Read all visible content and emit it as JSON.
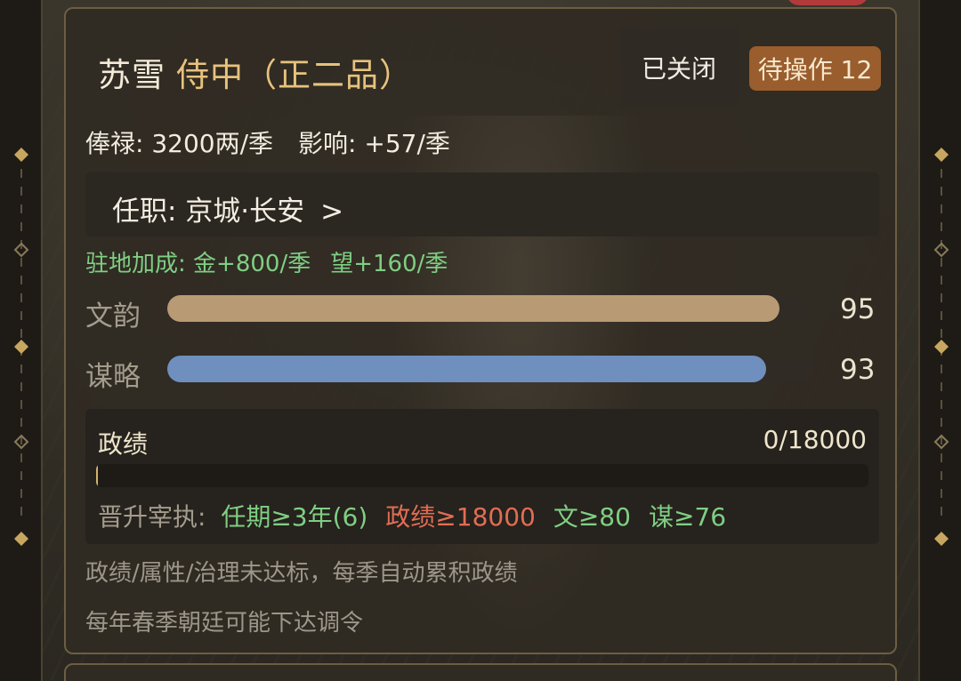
{
  "official": {
    "name": "苏雪",
    "rank": "侍中（正二品）"
  },
  "actions": {
    "closed_label": "已关闭",
    "pending_label": "待操作 12"
  },
  "income": {
    "salary": "俸禄: 3200两/季",
    "influence": "影响: +57/季"
  },
  "post": {
    "label": "任职: 京城·长安",
    "arrow": ">"
  },
  "bonus": {
    "label": "驻地加成:",
    "gold": "金+800/季",
    "prestige": "望+160/季"
  },
  "stats": [
    {
      "label": "文韵",
      "value": "95",
      "fill": 0.95,
      "color": "#b89a74"
    },
    {
      "label": "谋略",
      "value": "93",
      "fill": 0.93,
      "color": "#6f8fbf"
    }
  ],
  "performance": {
    "label": "政绩",
    "value": "0/18000",
    "progress": 0.0
  },
  "promotion": {
    "label": "晋升宰执:",
    "requirements": [
      {
        "text": "任期≥3年(6)",
        "met": true
      },
      {
        "text": "政绩≥18000",
        "met": false
      },
      {
        "text": "文≥80",
        "met": true
      },
      {
        "text": "谋≥76",
        "met": true
      }
    ]
  },
  "notes": [
    "政绩/属性/治理未达标，每季自动累积政绩",
    "每年春季朝廷可能下达调令"
  ]
}
